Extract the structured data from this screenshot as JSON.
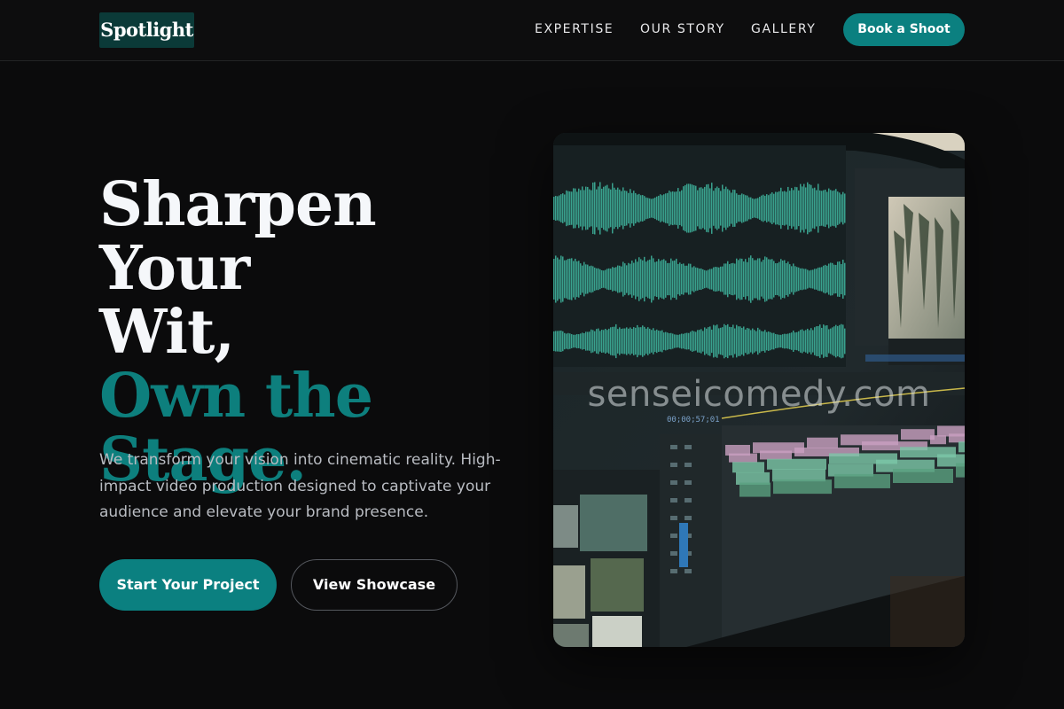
{
  "brand": {
    "logo_text": "Spotlight"
  },
  "nav": {
    "items": [
      {
        "label": "EXPERTISE"
      },
      {
        "label": "OUR STORY"
      },
      {
        "label": "GALLERY"
      }
    ],
    "cta_label": "Book a Shoot"
  },
  "hero": {
    "title_line1": "Sharpen Your",
    "title_line2": "Wit,",
    "title_accent_line1": "Own the",
    "title_accent_line2": "Stage.",
    "subtitle": "We transform your vision into cinematic reality. High-impact video production designed to captivate your audience and elevate your brand presence.",
    "primary_button": "Start Your Project",
    "secondary_button": "View Showcase"
  },
  "image": {
    "watermark": "senseicomedy.com",
    "timecode": "00;00;57;01",
    "depicts": "video-editing-timeline-monitor"
  },
  "colors": {
    "background": "#0b0b0c",
    "accent": "#0b8080",
    "accent_text": "#0d7f7d",
    "logo_bg": "#0b3a38",
    "waveform": "#3fb8a0",
    "clip_pink": "#c9a0c0",
    "clip_green": "#7cc7a8"
  }
}
